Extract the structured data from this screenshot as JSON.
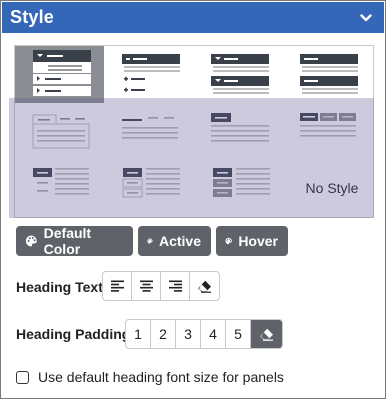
{
  "panel": {
    "title": "Style",
    "collapse_icon": "chevron-down-icon"
  },
  "style_grid": {
    "no_style_label": "No Style",
    "tiles": [
      {
        "name": "style-accordion-caret",
        "selected": true
      },
      {
        "name": "style-accordion-plus",
        "selected": false
      },
      {
        "name": "style-stacked-caret",
        "selected": false
      },
      {
        "name": "style-stacked-panels",
        "selected": false
      },
      {
        "name": "style-tabs-boxed",
        "selected": false
      },
      {
        "name": "style-tabs-underline",
        "selected": false
      },
      {
        "name": "style-tabs-dark-single",
        "selected": false
      },
      {
        "name": "style-tabs-dark-pills",
        "selected": false
      },
      {
        "name": "style-vertical-tabs-left",
        "selected": false
      },
      {
        "name": "style-vertical-tabs-boxed",
        "selected": false
      },
      {
        "name": "style-vertical-tabs-stack",
        "selected": false
      }
    ]
  },
  "color_buttons": [
    {
      "label": "Default Color",
      "icon": "palette-icon"
    },
    {
      "label": "Active",
      "icon": "palette-icon"
    },
    {
      "label": "Hover",
      "icon": "palette-icon"
    }
  ],
  "heading_text": {
    "label": "Heading Text",
    "options": [
      {
        "icon": "align-left-icon"
      },
      {
        "icon": "align-center-icon"
      },
      {
        "icon": "align-right-icon"
      },
      {
        "icon": "eraser-icon"
      }
    ]
  },
  "heading_padding": {
    "label": "Heading Padding",
    "options": [
      "1",
      "2",
      "3",
      "4",
      "5"
    ],
    "clear_icon": "eraser-icon",
    "active": "clear"
  },
  "font_size_option": {
    "label": "Use default heading font size for panels",
    "checked": false
  },
  "colors": {
    "header_bg": "#3467b8",
    "dark_button": "#5f6369",
    "tile_selected_bg": "#8a8d91",
    "tile_dark": "#3a4049",
    "tile_line": "#b5b5b5",
    "overlay": "rgba(100,90,150,0.32)"
  }
}
